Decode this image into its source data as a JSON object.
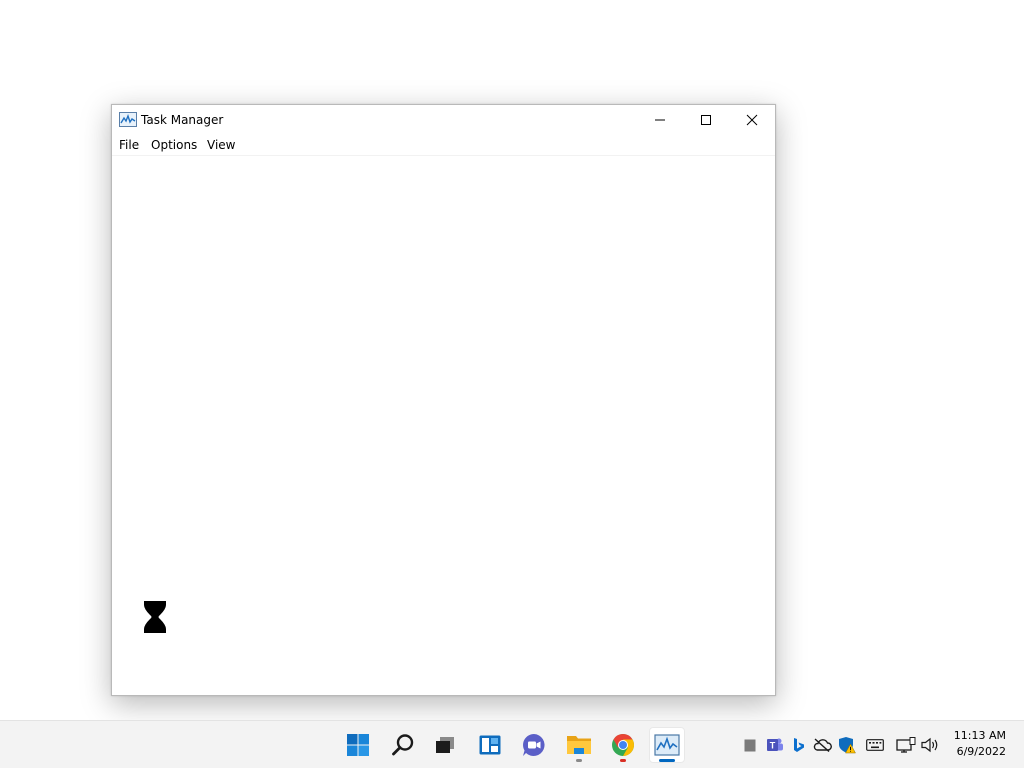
{
  "window": {
    "title": "Task Manager",
    "menu": {
      "file": "File",
      "options": "Options",
      "view": "View"
    },
    "controls": [
      "minimize",
      "maximize",
      "close"
    ]
  },
  "cursor": {
    "type": "busy-hourglass"
  },
  "taskbar": {
    "items": [
      "windows-start-icon",
      "search-icon",
      "task-view-icon",
      "widgets-icon",
      "teams-chat-icon",
      "file-explorer-icon",
      "chrome-icon",
      "task-manager-icon"
    ],
    "active": "task-manager-icon",
    "tray": [
      "tray-overflow-icon",
      "teams-tray-icon",
      "bing-icon",
      "onedrive-offline-icon",
      "windows-security-warning-icon",
      "keyboard-icon",
      "network-icon",
      "volume-icon"
    ],
    "clock": {
      "time": "11:13 AM",
      "date": "6/9/2022"
    }
  },
  "colors": {
    "accent": "#0067c0",
    "chrome_indicator": "#e04a3f",
    "taskbar_bg": "#f3f3f3"
  }
}
